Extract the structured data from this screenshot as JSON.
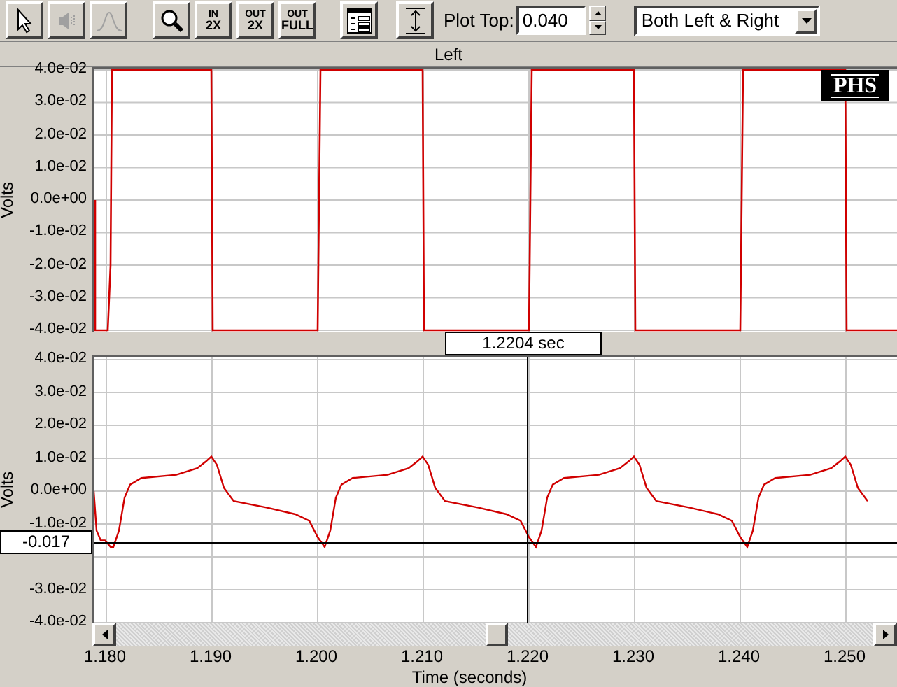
{
  "toolbar": {
    "buttons": [
      {
        "kind": "pointer",
        "disabled": false
      },
      {
        "kind": "speaker",
        "disabled": true
      },
      {
        "kind": "peak",
        "disabled": true
      },
      {
        "kind": "magnifier",
        "disabled": false
      },
      {
        "kind": "zoom_in",
        "disabled": false,
        "top": "IN",
        "bottom": "2X"
      },
      {
        "kind": "zoom_out",
        "disabled": false,
        "top": "OUT",
        "bottom": "2X"
      },
      {
        "kind": "zoom_full",
        "disabled": false,
        "top": "OUT",
        "bottom": "FULL"
      },
      {
        "kind": "list",
        "disabled": false
      },
      {
        "kind": "fit",
        "disabled": false
      }
    ],
    "plot_top": {
      "label": "Plot Top:",
      "value": "0.040"
    },
    "channel_select": {
      "value": "Both Left & Right"
    }
  },
  "plots": [
    {
      "title": "Left",
      "kind": "square",
      "y_label": "Volts",
      "logo": "PHS",
      "y_ticks": [
        "4.0e-02",
        "3.0e-02",
        "2.0e-02",
        "1.0e-02",
        "0.0e+00",
        "-1.0e-02",
        "-2.0e-02",
        "-3.0e-02",
        "-4.0e-02"
      ]
    },
    {
      "kind": "response",
      "y_label": "Volts",
      "y_ticks": [
        "4.0e-02",
        "3.0e-02",
        "2.0e-02",
        "1.0e-02",
        "0.0e+00",
        "-1.0e-02",
        "-3.0e-02",
        "-4.0e-02"
      ],
      "cursor": {
        "time": "1.2204 sec",
        "value": "-0.017"
      }
    }
  ],
  "x_axis": {
    "ticks": [
      "1.180",
      "1.190",
      "1.200",
      "1.210",
      "1.220",
      "1.230",
      "1.240",
      "1.250"
    ],
    "label": "Time (seconds)"
  }
}
